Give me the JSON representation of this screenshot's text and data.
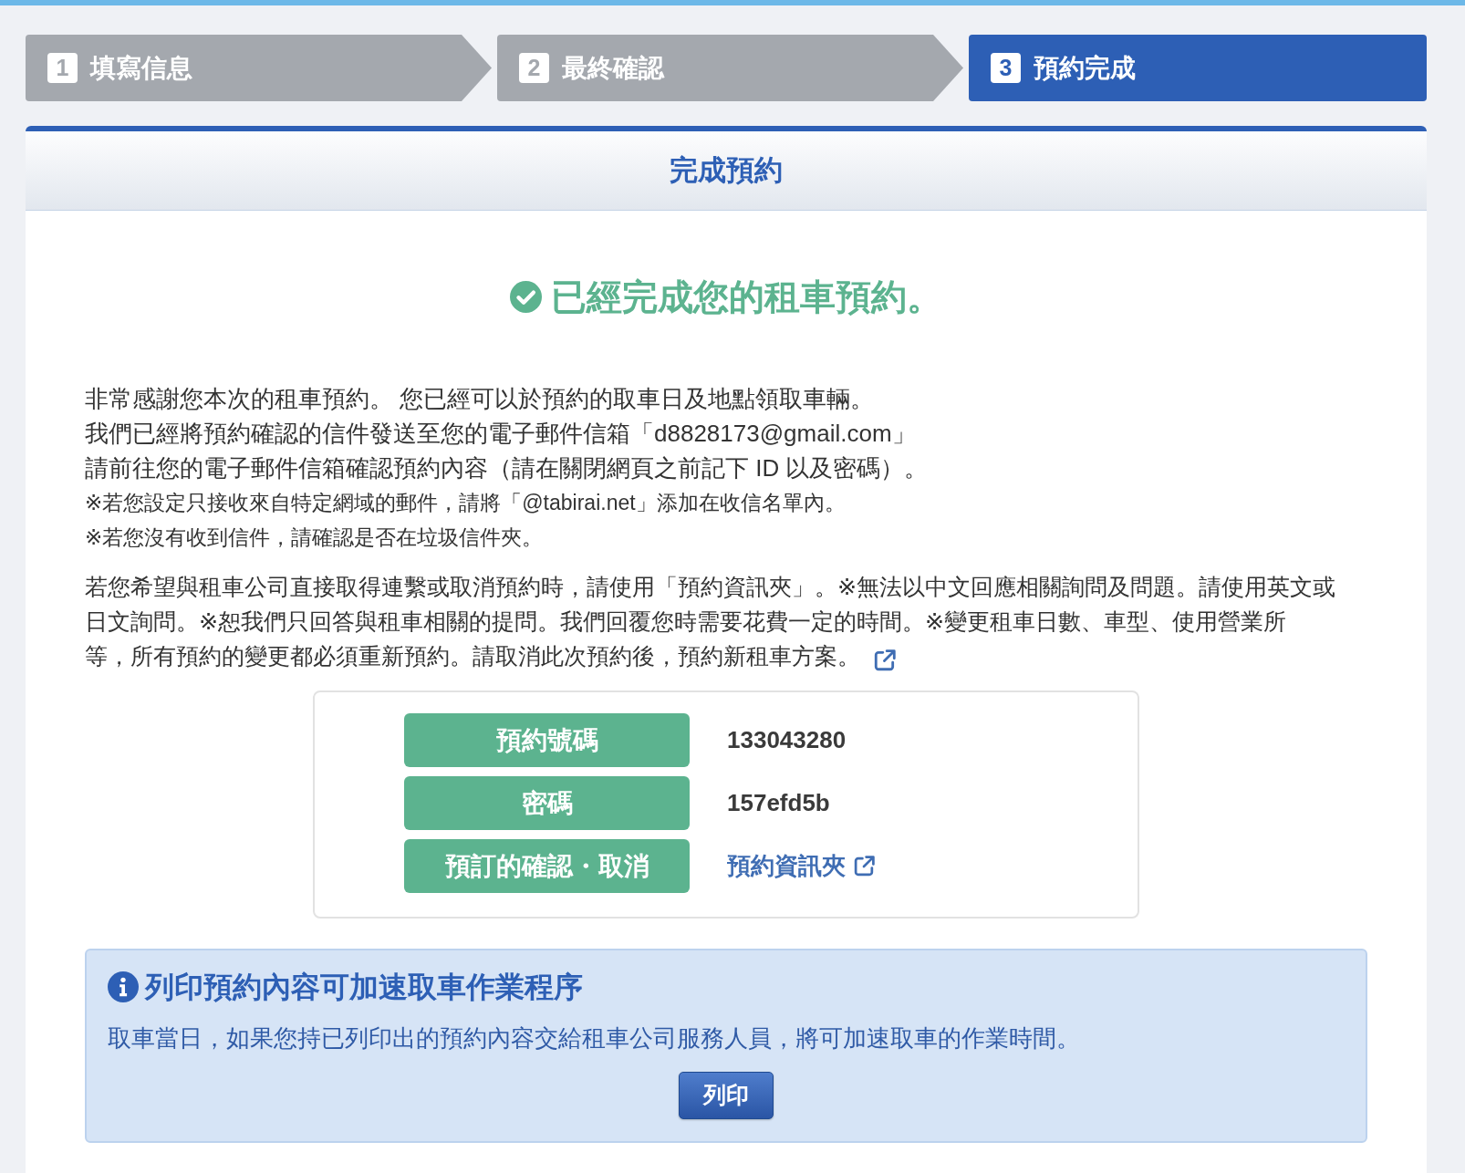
{
  "steps": [
    {
      "number": "1",
      "label": "填寫信息",
      "selected": false
    },
    {
      "number": "2",
      "label": "最終確認",
      "selected": false
    },
    {
      "number": "3",
      "label": "預約完成",
      "selected": true
    }
  ],
  "panel": {
    "title": "完成預約",
    "success_message": "已經完成您的租車預約。",
    "notes": [
      {
        "kind": "normal",
        "text": "非常感謝您本次的租車預約。 您已經可以於預約的取車日及地點領取車輛。"
      },
      {
        "kind": "normal",
        "text": "我們已經將預約確認的信件發送至您的電子郵件信箱「d8828173@gmail.com」"
      },
      {
        "kind": "normal",
        "text": "請前往您的電子郵件信箱確認預約內容（請在關閉網頁之前記下 ID 以及密碼）。"
      },
      {
        "kind": "small",
        "text": "※若您設定只接收來自特定網域的郵件，請將「@tabirai.net」添加在收信名單內。"
      },
      {
        "kind": "small",
        "text": "※若您沒有收到信件，請確認是否在垃圾信件夾。"
      }
    ],
    "contact_paragraph": {
      "lines": [
        "若您希望與租車公司直接取得連繫或取消預約時，請使用「預約資訊夾」。※無法以中文回應相關詢問及問題。請使用英文或",
        "日文詢問。※恕我們只回答與租車相關的提問。我們回覆您時需要花費一定的時間。※變更租車日數、車型、使用營業所",
        "等，所有預約的變更都必須重新預約。請取消此次預約後，預約新租車方案。"
      ]
    },
    "details": [
      {
        "kind": "text",
        "label": "預約號碼",
        "value": "133043280"
      },
      {
        "kind": "text",
        "label": "密碼",
        "value": "157efd5b"
      },
      {
        "kind": "link",
        "label": "預訂的確認・取消",
        "value": "預約資訊夾"
      }
    ],
    "print_notice": {
      "title": "列印預約內容可加速取車作業程序",
      "text": "取車當日，如果您持已列印出的預約內容交給租車公司服務人員，將可加速取車的作業時間。",
      "button": "列印"
    }
  }
}
